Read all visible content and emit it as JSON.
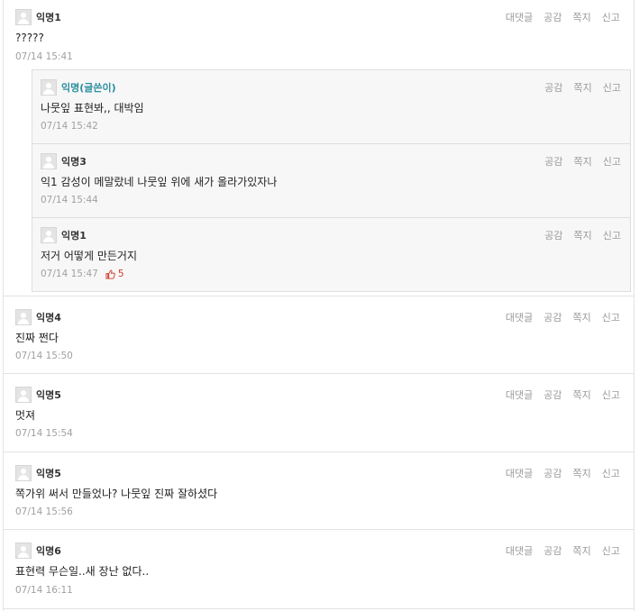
{
  "actions": {
    "reply": "대댓글",
    "like": "공감",
    "message": "쪽지",
    "report": "신고"
  },
  "comments": [
    {
      "author": "익명1",
      "text": "?????",
      "time": "07/14 15:41",
      "replies": [
        {
          "author": "익명(글쓴이)",
          "is_op": true,
          "text": "나뭇잎 표현봐,, 대박임",
          "time": "07/14 15:42"
        },
        {
          "author": "익명3",
          "text": "익1 감성이 메말랐네 나뭇잎 위에 새가 올라가있자나",
          "time": "07/14 15:44"
        },
        {
          "author": "익명1",
          "text": "저거 어떻게 만든거지",
          "time": "07/14 15:47",
          "likes": "5"
        }
      ]
    },
    {
      "author": "익명4",
      "text": "진짜 쩐다",
      "time": "07/14 15:50"
    },
    {
      "author": "익명5",
      "text": "멋져",
      "time": "07/14 15:54"
    },
    {
      "author": "익명5",
      "text": "쪽가위 써서 만들었나? 나뭇잎 진짜 잘하셨다",
      "time": "07/14 15:56"
    },
    {
      "author": "익명6",
      "text": "표현력 무슨일..새 장난 없다..",
      "time": "07/14 16:11"
    }
  ],
  "colors": {
    "op_author": "#2a8ea0",
    "like": "#d03a2b",
    "meta": "#a0a0a0"
  }
}
